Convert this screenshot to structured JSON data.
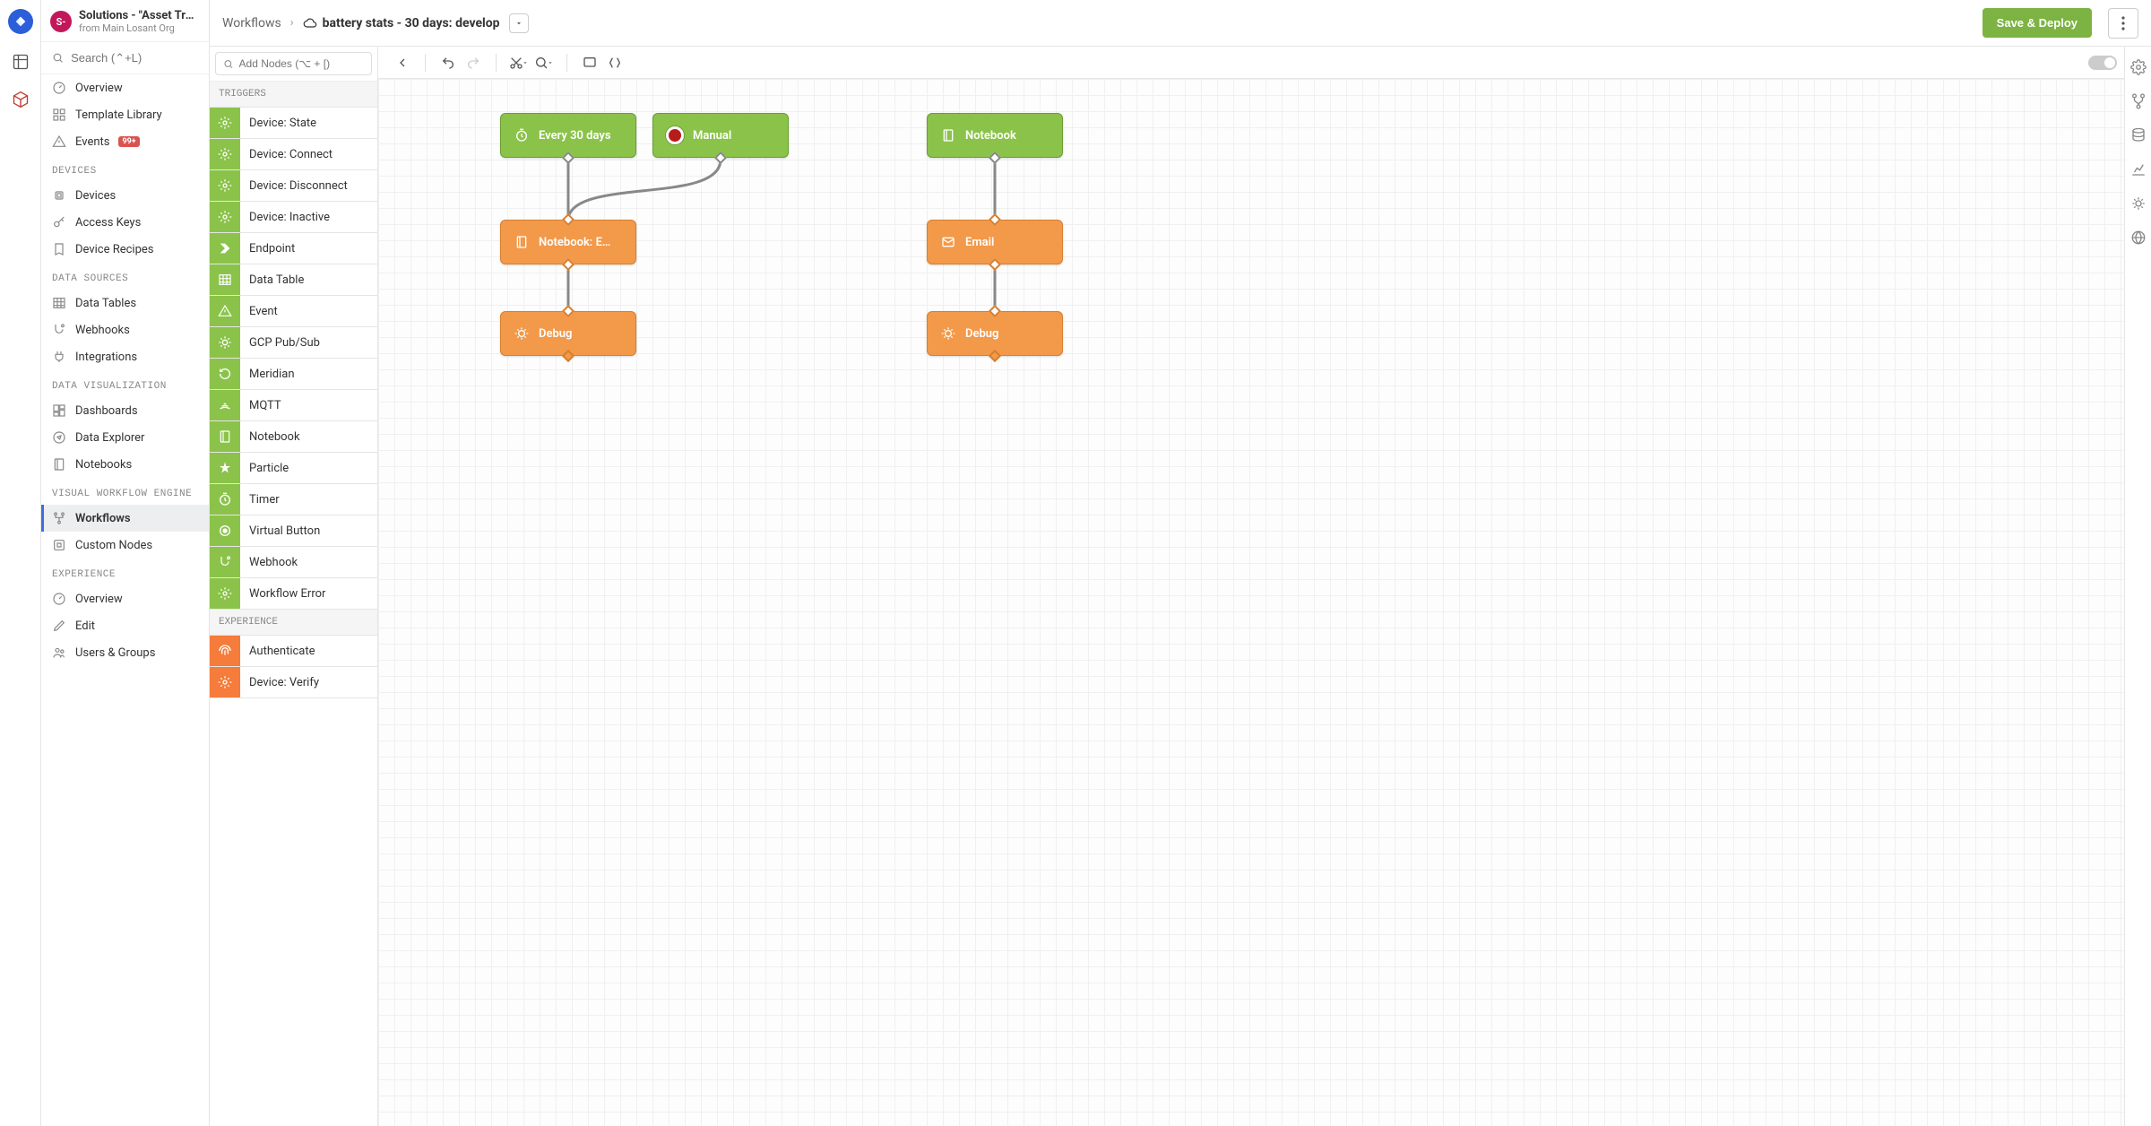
{
  "app": {
    "title": "Solutions - \"Asset Trac…",
    "subtitle": "from Main Losant Org",
    "badge": "S-"
  },
  "search": {
    "placeholder": "Search (⌃+L)"
  },
  "nav": {
    "top": [
      {
        "icon": "gauge",
        "label": "Overview"
      },
      {
        "icon": "grid",
        "label": "Template Library"
      },
      {
        "icon": "alert",
        "label": "Events",
        "badge": "99+"
      }
    ],
    "sections": [
      {
        "title": "DEVICES",
        "items": [
          {
            "icon": "cpu",
            "label": "Devices"
          },
          {
            "icon": "key",
            "label": "Access Keys"
          },
          {
            "icon": "recipe",
            "label": "Device Recipes"
          }
        ]
      },
      {
        "title": "DATA SOURCES",
        "items": [
          {
            "icon": "table",
            "label": "Data Tables"
          },
          {
            "icon": "hook",
            "label": "Webhooks"
          },
          {
            "icon": "plug",
            "label": "Integrations"
          }
        ]
      },
      {
        "title": "DATA VISUALIZATION",
        "items": [
          {
            "icon": "dash",
            "label": "Dashboards"
          },
          {
            "icon": "compass",
            "label": "Data Explorer"
          },
          {
            "icon": "book",
            "label": "Notebooks"
          }
        ]
      },
      {
        "title": "VISUAL WORKFLOW ENGINE",
        "items": [
          {
            "icon": "flow",
            "label": "Workflows",
            "active": true
          },
          {
            "icon": "custom",
            "label": "Custom Nodes"
          }
        ]
      },
      {
        "title": "EXPERIENCE",
        "items": [
          {
            "icon": "gauge",
            "label": "Overview"
          },
          {
            "icon": "pencil",
            "label": "Edit"
          },
          {
            "icon": "users",
            "label": "Users & Groups"
          }
        ]
      }
    ]
  },
  "breadcrumbs": {
    "root": "Workflows",
    "current": "battery stats - 30 days: develop"
  },
  "actions": {
    "save": "Save & Deploy"
  },
  "palette": {
    "search_placeholder": "Add Nodes (⌥ + [)",
    "sections": [
      {
        "title": "TRIGGERS",
        "color": "green",
        "items": [
          {
            "label": "Device: State",
            "icon": "gear"
          },
          {
            "label": "Device: Connect",
            "icon": "gear"
          },
          {
            "label": "Device: Disconnect",
            "icon": "gear"
          },
          {
            "label": "Device: Inactive",
            "icon": "gear"
          },
          {
            "label": "Endpoint",
            "icon": "arrow"
          },
          {
            "label": "Data Table",
            "icon": "table"
          },
          {
            "label": "Event",
            "icon": "alert"
          },
          {
            "label": "GCP Pub/Sub",
            "icon": "sun"
          },
          {
            "label": "Meridian",
            "icon": "loop"
          },
          {
            "label": "MQTT",
            "icon": "signal"
          },
          {
            "label": "Notebook",
            "icon": "book"
          },
          {
            "label": "Particle",
            "icon": "star"
          },
          {
            "label": "Timer",
            "icon": "timer"
          },
          {
            "label": "Virtual Button",
            "icon": "dot"
          },
          {
            "label": "Webhook",
            "icon": "hook"
          },
          {
            "label": "Workflow Error",
            "icon": "gear"
          }
        ]
      },
      {
        "title": "EXPERIENCE",
        "color": "orange",
        "items": [
          {
            "label": "Authenticate",
            "icon": "finger"
          },
          {
            "label": "Device: Verify",
            "icon": "gear"
          }
        ]
      }
    ]
  },
  "canvas_nodes": {
    "n1": {
      "label": "Every 30 days"
    },
    "n2": {
      "label": "Manual"
    },
    "n3": {
      "label": "Notebook: E…"
    },
    "n4": {
      "label": "Debug"
    },
    "n5": {
      "label": "Notebook"
    },
    "n6": {
      "label": "Email"
    },
    "n7": {
      "label": "Debug"
    }
  }
}
